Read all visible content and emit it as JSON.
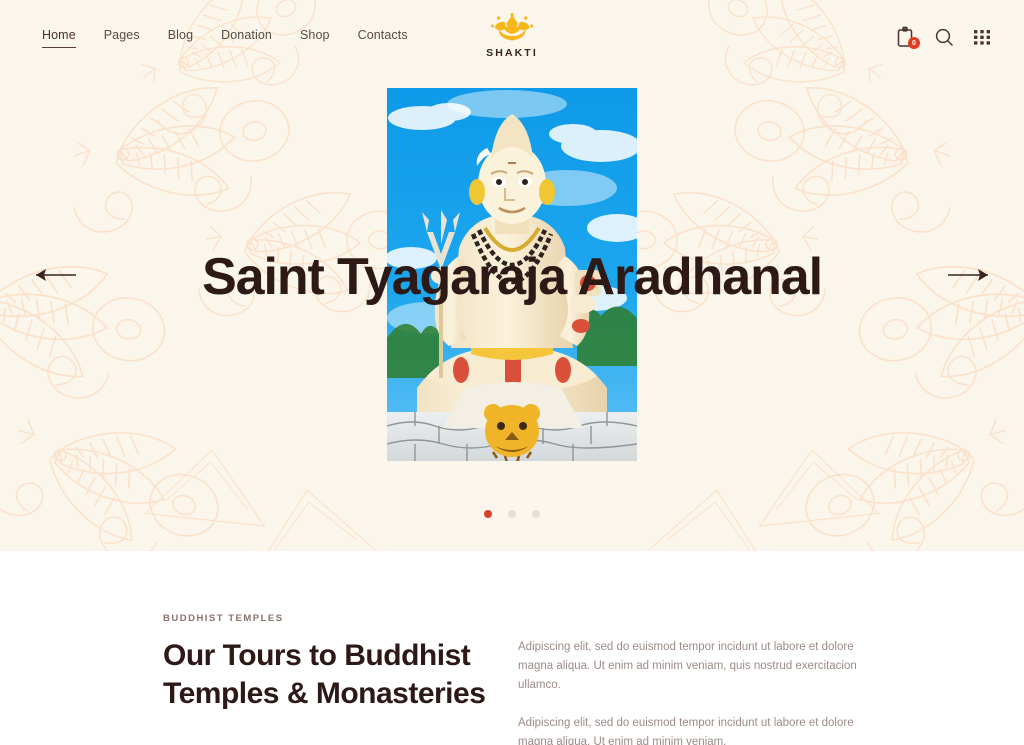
{
  "brand": {
    "name": "SHAKTI",
    "logo_icon": "lotus-icon",
    "logo_color": "#f5b719"
  },
  "nav": {
    "items": [
      {
        "label": "Home",
        "active": true
      },
      {
        "label": "Pages",
        "active": false
      },
      {
        "label": "Blog",
        "active": false
      },
      {
        "label": "Donation",
        "active": false
      },
      {
        "label": "Shop",
        "active": false
      },
      {
        "label": "Contacts",
        "active": false
      }
    ]
  },
  "header_actions": {
    "cart": {
      "icon": "shopping-bag-icon",
      "badge_count": "0",
      "badge_color": "#e03c23"
    },
    "search": {
      "icon": "search-icon"
    },
    "grid": {
      "icon": "grid-menu-icon"
    }
  },
  "slider": {
    "title": "Saint Tyagaraja Aradhanal",
    "image_alt": "shiva-statue-photo",
    "prev_icon": "arrow-left-icon",
    "next_icon": "arrow-right-icon",
    "dots": [
      {
        "active": true
      },
      {
        "active": false
      },
      {
        "active": false
      }
    ],
    "active_dot_color": "#d8402a",
    "inactive_dot_color": "#e6e0d5",
    "background_color": "#fbf6ec"
  },
  "intro": {
    "eyebrow": "BUDDHIST TEMPLES",
    "heading_line1": "Our Tours to Buddhist",
    "heading_line2": "Temples & Monasteries",
    "paragraphs": [
      "Adipiscing elit, sed do euismod tempor incidunt ut labore et dolore magna aliqua. Ut enim ad minim veniam, quis nostrud exercitacion ullamco.",
      "Adipiscing elit, sed do euismod tempor incidunt ut labore et dolore magna aliqua. Ut enim ad minim veniam."
    ]
  }
}
